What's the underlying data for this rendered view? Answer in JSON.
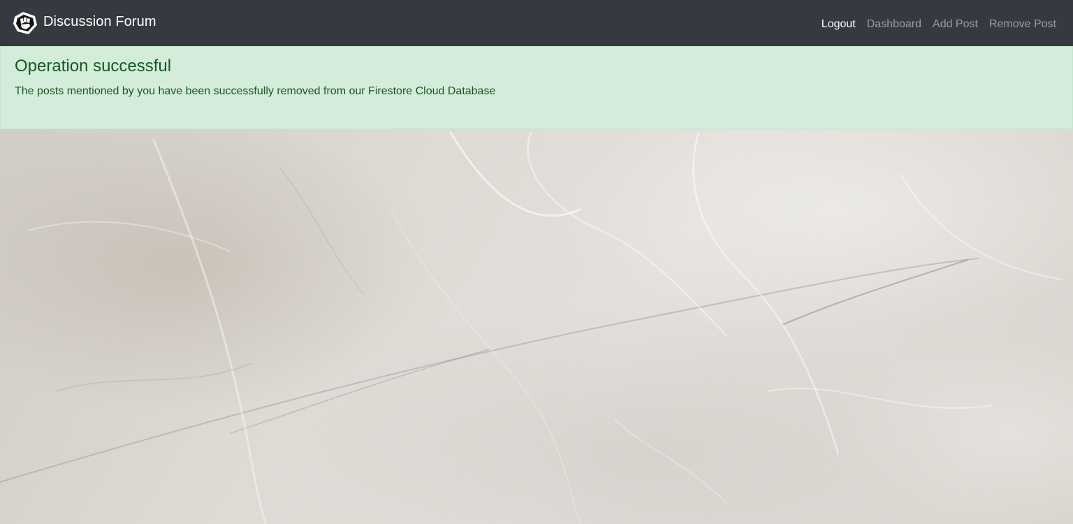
{
  "navbar": {
    "brand_title": "Discussion Forum",
    "links": [
      {
        "label": "Logout",
        "active": true
      },
      {
        "label": "Dashboard",
        "active": false
      },
      {
        "label": "Add Post",
        "active": false
      },
      {
        "label": "Remove Post",
        "active": false
      }
    ]
  },
  "alert": {
    "heading": "Operation successful",
    "message": "The posts mentioned by you have been successfully removed from our Firestore Cloud Database"
  },
  "colors": {
    "navbar_bg": "#343a40",
    "alert_bg": "#d4edda",
    "alert_text": "#155724"
  }
}
